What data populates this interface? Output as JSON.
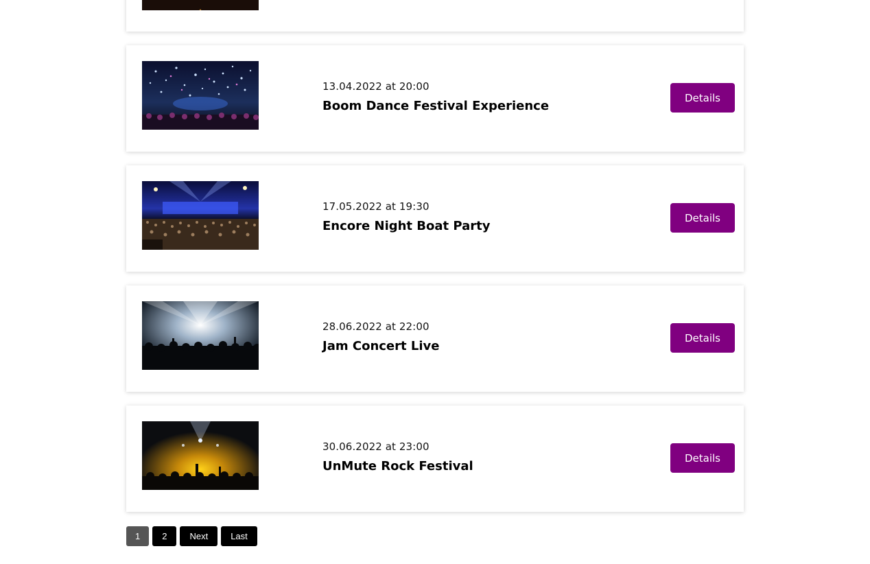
{
  "events": [
    {
      "date": "13.04.2022 at 20:00",
      "title": "Boom Dance Festival Experience",
      "details_label": "Details",
      "image": "confetti-crowd-image"
    },
    {
      "date": "17.05.2022 at 19:30",
      "title": "Encore Night Boat Party",
      "details_label": "Details",
      "image": "arena-blue-lights-image"
    },
    {
      "date": "28.06.2022 at 22:00",
      "title": "Jam Concert Live",
      "details_label": "Details",
      "image": "white-spotlights-crowd-image"
    },
    {
      "date": "30.06.2022 at 23:00",
      "title": "UnMute Rock Festival",
      "details_label": "Details",
      "image": "yellow-stage-crowd-image"
    }
  ],
  "pagination": {
    "current": "1",
    "page2": "2",
    "next": "Next",
    "last": "Last"
  },
  "colors": {
    "accent": "#800080",
    "pager_bg": "#000000",
    "pager_current_bg": "#555555"
  }
}
